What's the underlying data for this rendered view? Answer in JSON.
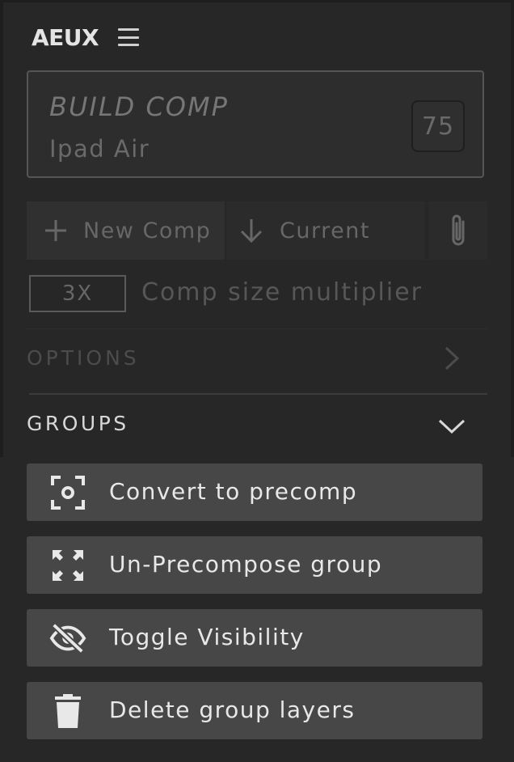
{
  "header": {
    "title": "AEUX",
    "menu_icon": "hamburger-menu-icon"
  },
  "build": {
    "title": "BUILD COMP",
    "preset": "Ipad Air",
    "count": "75"
  },
  "buttons": {
    "new_comp": "New Comp",
    "current": "Current",
    "new_comp_icon": "plus-icon",
    "current_icon": "arrow-down-icon",
    "attach_icon": "paperclip-icon"
  },
  "multiplier": {
    "value": "3X",
    "label": "Comp size multiplier"
  },
  "sections": {
    "options": {
      "label": "OPTIONS",
      "state": "collapsed"
    },
    "groups": {
      "label": "GROUPS",
      "state": "expanded"
    }
  },
  "actions": [
    {
      "label": "Convert to precomp",
      "icon": "focus-frame-icon"
    },
    {
      "label": "Un-Precompose group",
      "icon": "expand-arrows-icon"
    },
    {
      "label": "Toggle Visibility",
      "icon": "eye-off-icon"
    },
    {
      "label": "Delete group layers",
      "icon": "trash-icon"
    }
  ],
  "colors": {
    "background": "#272727",
    "button": "#474747",
    "text_active": "#e8e8e8",
    "text_dim": "#676767"
  }
}
